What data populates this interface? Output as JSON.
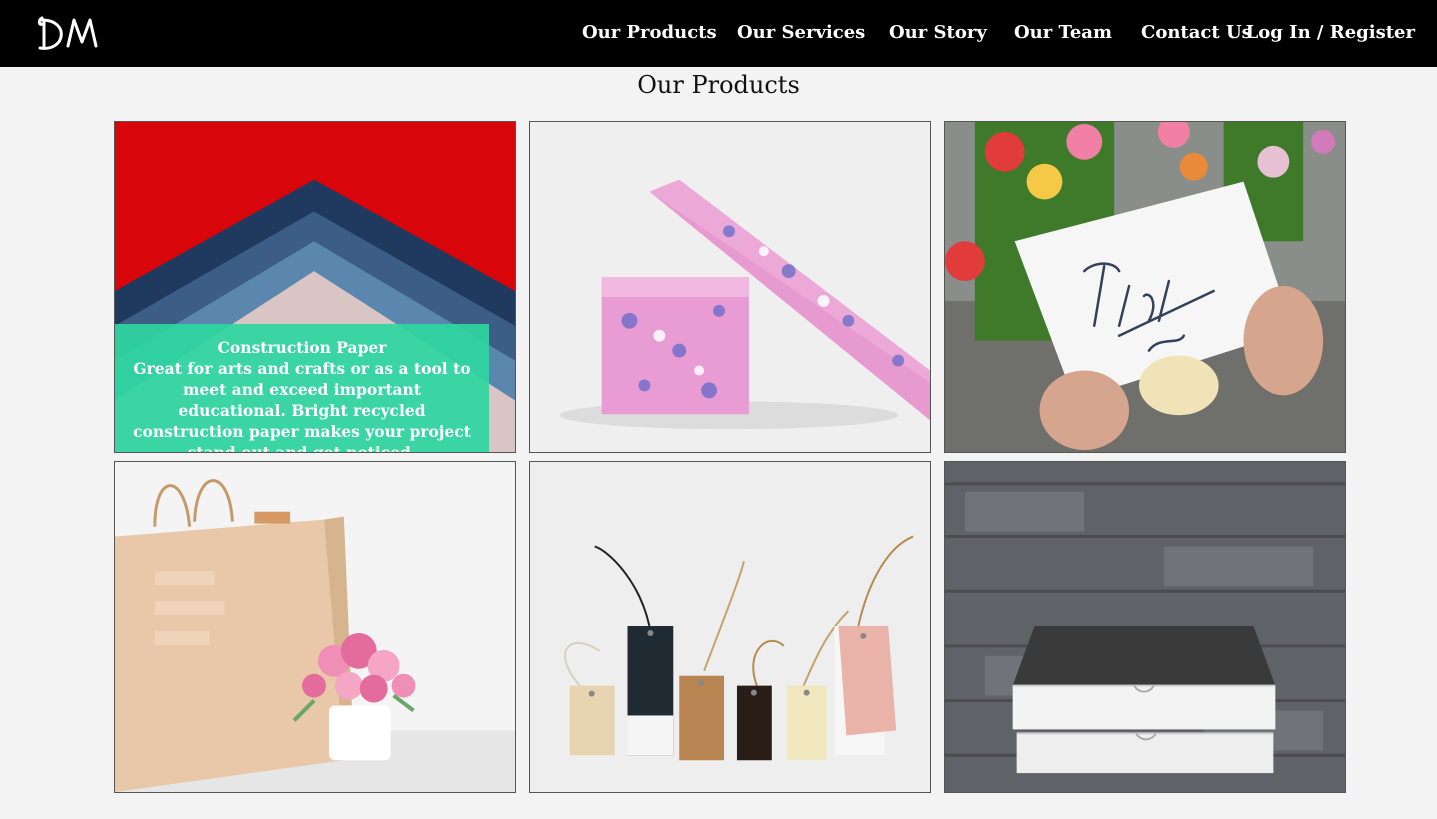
{
  "brand": {
    "logo_text": "DM"
  },
  "nav": {
    "items": [
      "Our Products",
      "Our Services",
      "Our Story",
      "Our Team",
      "Contact Us",
      "Log In / Register"
    ]
  },
  "page": {
    "title": "Our Products"
  },
  "products": [
    {
      "image": "construction-paper-image",
      "title": "Construction Paper",
      "description": "Great for arts and crafts or as a tool to meet and exceed important educational. Bright recycled construction paper makes your project stand out and get noticed."
    },
    {
      "image": "wrapping-paper-image"
    },
    {
      "image": "thank-you-card-image"
    },
    {
      "image": "paper-bag-image"
    },
    {
      "image": "gift-tags-image"
    },
    {
      "image": "white-boxes-image"
    }
  ],
  "colors": {
    "navbar": "#000000",
    "background": "#f3f3f3",
    "overlay": "#2ed6a0"
  }
}
